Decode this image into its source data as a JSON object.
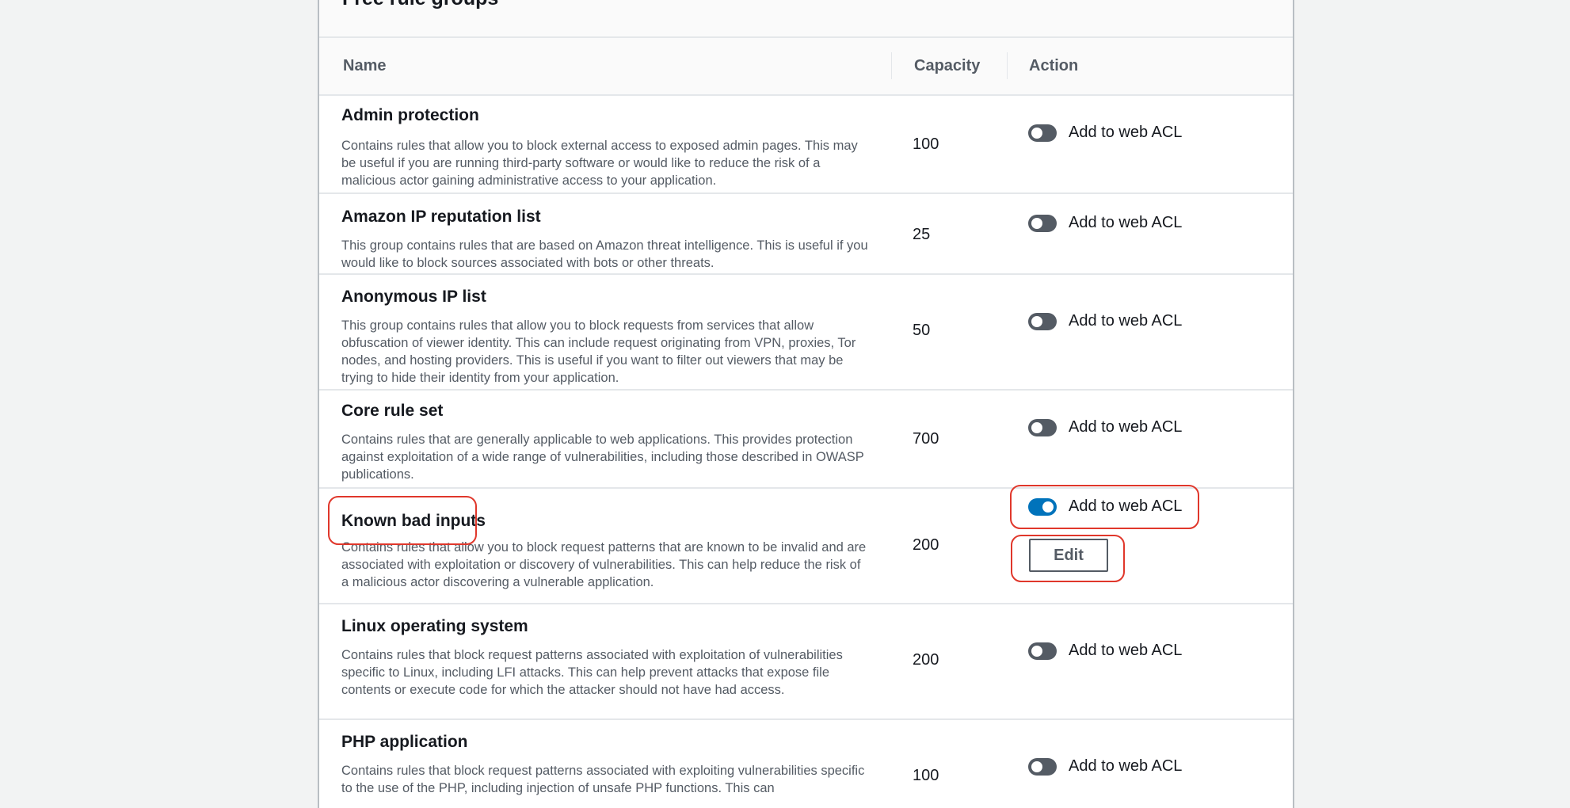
{
  "section": {
    "title": "Free rule groups"
  },
  "table": {
    "columns": {
      "name": "Name",
      "capacity": "Capacity",
      "action": "Action"
    },
    "rows": [
      {
        "name": "Admin protection",
        "description": "Contains rules that allow you to block external access to exposed admin pages. This may be useful if you are running third-party software or would like to reduce the risk of a malicious actor gaining administrative access to your application.",
        "capacity": "100",
        "action_label": "Add to web ACL",
        "enabled": false
      },
      {
        "name": "Amazon IP reputation list",
        "description": "This group contains rules that are based on Amazon threat intelligence. This is useful if you would like to block sources associated with bots or other threats.",
        "capacity": "25",
        "action_label": "Add to web ACL",
        "enabled": false
      },
      {
        "name": "Anonymous IP list",
        "description": "This group contains rules that allow you to block requests from services that allow obfuscation of viewer identity. This can include request originating from VPN, proxies, Tor nodes, and hosting providers. This is useful if you want to filter out viewers that may be trying to hide their identity from your application.",
        "capacity": "50",
        "action_label": "Add to web ACL",
        "enabled": false
      },
      {
        "name": "Core rule set",
        "description": "Contains rules that are generally applicable to web applications. This provides protection against exploitation of a wide range of vulnerabilities, including those described in OWASP publications.",
        "capacity": "700",
        "action_label": "Add to web ACL",
        "enabled": false
      },
      {
        "name": "Known bad inputs",
        "description": "Contains rules that allow you to block request patterns that are known to be invalid and are associated with exploitation or discovery of vulnerabilities. This can help reduce the risk of a malicious actor discovering a vulnerable application.",
        "capacity": "200",
        "action_label": "Add to web ACL",
        "enabled": true,
        "edit_label": "Edit"
      },
      {
        "name": "Linux operating system",
        "description": "Contains rules that block request patterns associated with exploitation of vulnerabilities specific to Linux, including LFI attacks. This can help prevent attacks that expose file contents or execute code for which the attacker should not have had access.",
        "capacity": "200",
        "action_label": "Add to web ACL",
        "enabled": false
      },
      {
        "name": "PHP application",
        "description": "Contains rules that block request patterns associated with exploiting vulnerabilities specific to the use of the PHP, including injection of unsafe PHP functions. This can",
        "capacity": "100",
        "action_label": "Add to web ACL",
        "enabled": false
      }
    ]
  },
  "colors": {
    "highlight": "#e0372b",
    "toggle_on": "#0073bb",
    "toggle_off": "#545b64"
  }
}
